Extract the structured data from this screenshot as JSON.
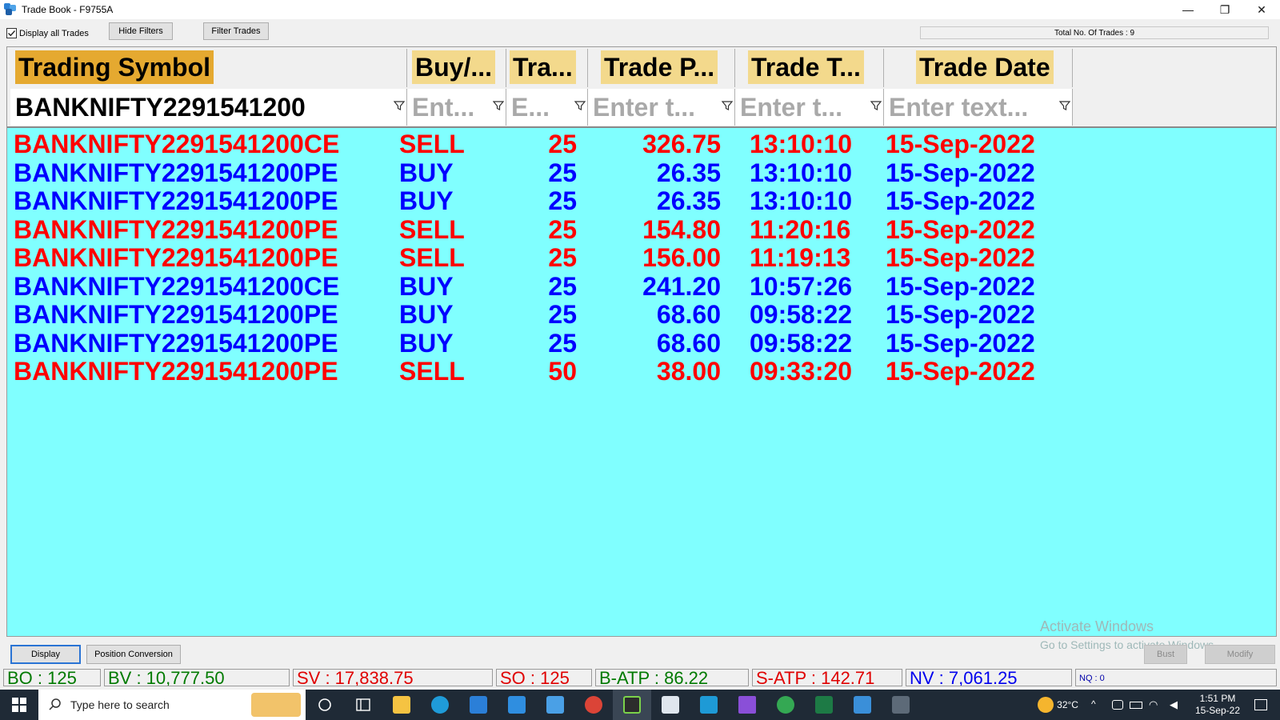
{
  "window": {
    "title": "Trade Book - F9755A",
    "minimize_label": "—",
    "restore_label": "❐",
    "close_label": "✕"
  },
  "toolbar": {
    "display_all_label": "Display all Trades",
    "display_all_checked": true,
    "hide_filters_label": "Hide Filters",
    "filter_trades_label": "Filter Trades",
    "total_trades_label": "Total No. Of Trades : 9"
  },
  "columns": [
    {
      "header": "Trading Symbol",
      "filter_value": "BANKNIFTY2291541200",
      "filter_placeholder": ""
    },
    {
      "header": "Buy/...",
      "filter_value": "",
      "filter_placeholder": "Ent..."
    },
    {
      "header": "Tra...",
      "filter_value": "",
      "filter_placeholder": "E..."
    },
    {
      "header": "Trade P...",
      "filter_value": "",
      "filter_placeholder": "Enter t..."
    },
    {
      "header": "Trade T...",
      "filter_value": "",
      "filter_placeholder": "Enter t..."
    },
    {
      "header": "Trade Date",
      "filter_value": "",
      "filter_placeholder": "Enter text..."
    }
  ],
  "trades": [
    {
      "symbol": "BANKNIFTY2291541200CE",
      "side": "SELL",
      "qty": "25",
      "price": "326.75",
      "time": "13:10:10",
      "date": "15-Sep-2022"
    },
    {
      "symbol": "BANKNIFTY2291541200PE",
      "side": "BUY",
      "qty": "25",
      "price": "26.35",
      "time": "13:10:10",
      "date": "15-Sep-2022"
    },
    {
      "symbol": "BANKNIFTY2291541200PE",
      "side": "BUY",
      "qty": "25",
      "price": "26.35",
      "time": "13:10:10",
      "date": "15-Sep-2022"
    },
    {
      "symbol": "BANKNIFTY2291541200PE",
      "side": "SELL",
      "qty": "25",
      "price": "154.80",
      "time": "11:20:16",
      "date": "15-Sep-2022"
    },
    {
      "symbol": "BANKNIFTY2291541200PE",
      "side": "SELL",
      "qty": "25",
      "price": "156.00",
      "time": "11:19:13",
      "date": "15-Sep-2022"
    },
    {
      "symbol": "BANKNIFTY2291541200CE",
      "side": "BUY",
      "qty": "25",
      "price": "241.20",
      "time": "10:57:26",
      "date": "15-Sep-2022"
    },
    {
      "symbol": "BANKNIFTY2291541200PE",
      "side": "BUY",
      "qty": "25",
      "price": "68.60",
      "time": "09:58:22",
      "date": "15-Sep-2022"
    },
    {
      "symbol": "BANKNIFTY2291541200PE",
      "side": "BUY",
      "qty": "25",
      "price": "68.60",
      "time": "09:58:22",
      "date": "15-Sep-2022"
    },
    {
      "symbol": "BANKNIFTY2291541200PE",
      "side": "SELL",
      "qty": "50",
      "price": "38.00",
      "time": "09:33:20",
      "date": "15-Sep-2022"
    }
  ],
  "watermark": {
    "line1": "Activate Windows",
    "line2": "Go to Settings to activate Windows."
  },
  "bottom": {
    "display_label": "Display",
    "position_conversion_label": "Position Conversion",
    "bust_label": "Bust",
    "modify_label": "Modify"
  },
  "stats": {
    "bo": "BO : 125",
    "bv": "BV : 10,777.50",
    "sv": "SV : 17,838.75",
    "so": "SO : 125",
    "batp": "B-ATP : 86.22",
    "satp": "S-ATP : 142.71",
    "nv": "NV : 7,061.25",
    "nq": "NQ : 0"
  },
  "taskbar": {
    "search_placeholder": "Type here to search",
    "temperature": "32°C",
    "time": "1:51 PM",
    "date": "15-Sep-22"
  },
  "colors": {
    "sell": "#ff0000",
    "buy": "#0000ff",
    "grid_bg": "#80ffff",
    "header_highlight": "#e5a930"
  },
  "icons": {
    "filter": "filter-icon",
    "start": "windows-start-icon",
    "search": "search-icon"
  }
}
